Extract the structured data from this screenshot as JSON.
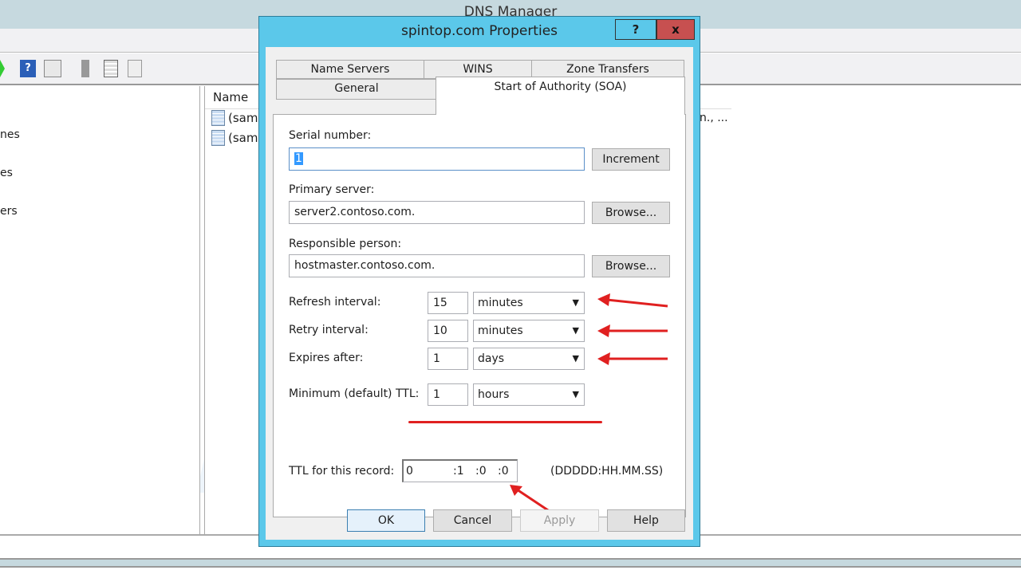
{
  "background_window": {
    "title": "DNS Manager",
    "tree_items": [
      "nes",
      "es",
      "ers"
    ],
    "list_header": "Name",
    "list_items": [
      "(sam",
      "(sam"
    ],
    "partial_cell": "n., ..."
  },
  "dialog": {
    "title": "spintop.com Properties",
    "help_btn": "?",
    "close_btn": "x",
    "tabs_row1": [
      "Name Servers",
      "WINS",
      "Zone Transfers"
    ],
    "tabs_row2": [
      "General",
      "Start of Authority (SOA)"
    ],
    "selected_tab": "Start of Authority (SOA)",
    "serial_label": "Serial number:",
    "serial_value": "1",
    "increment": "Increment",
    "primary_label": "Primary server:",
    "primary_value": "server2.contoso.com.",
    "browse": "Browse...",
    "responsible_label": "Responsible person:",
    "responsible_value": "hostmaster.contoso.com.",
    "intervals": [
      {
        "label": "Refresh interval:",
        "value": "15",
        "unit": "minutes"
      },
      {
        "label": "Retry interval:",
        "value": "10",
        "unit": "minutes"
      },
      {
        "label": "Expires after:",
        "value": "1",
        "unit": "days"
      },
      {
        "label": "Minimum (default) TTL:",
        "value": "1",
        "unit": "hours"
      }
    ],
    "ttl_label": "TTL for this record:",
    "ttl": {
      "days": "0",
      "hours": ":1",
      "minutes": ":0",
      "seconds": ":0"
    },
    "ttl_format": "(DDDDD:HH.MM.SS)",
    "buttons": {
      "ok": "OK",
      "cancel": "Cancel",
      "apply": "Apply",
      "help": "Help"
    }
  },
  "annotation_color": "#e02020",
  "accent": "#5bc8ea",
  "watermark": "Networkedminds.com"
}
